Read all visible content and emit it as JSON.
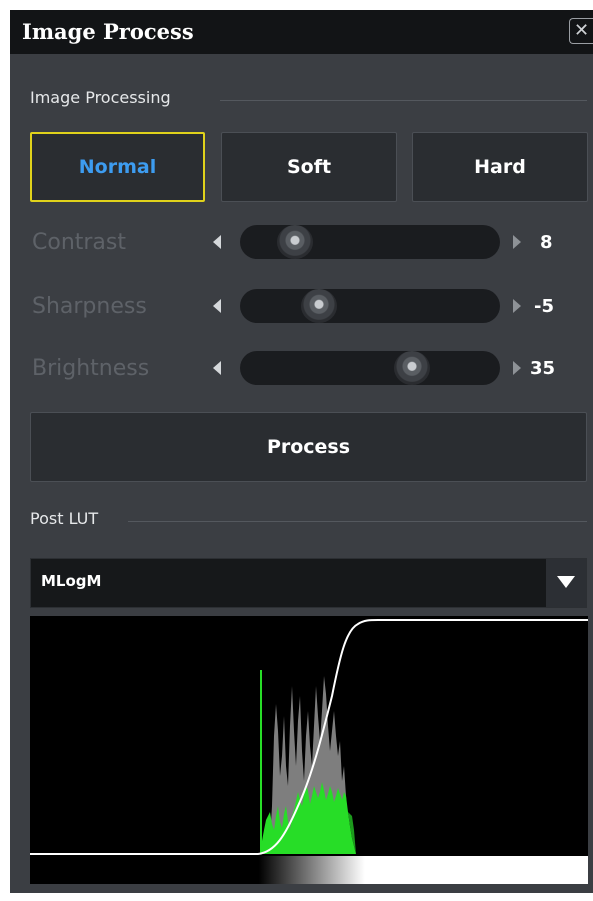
{
  "window": {
    "title": "Image Process",
    "close_icon_glyph": "✕"
  },
  "image_processing": {
    "section_label": "Image Processing",
    "modes": [
      {
        "label": "Normal",
        "active": true
      },
      {
        "label": "Soft",
        "active": false
      },
      {
        "label": "Hard",
        "active": false
      }
    ],
    "sliders": [
      {
        "label": "Contrast",
        "value": "8",
        "level": 0.16
      },
      {
        "label": "Sharpness",
        "value": "-5",
        "level": 0.27
      },
      {
        "label": "Brightness",
        "value": "35",
        "level": 0.69
      }
    ],
    "process_label": "Process"
  },
  "post_lut": {
    "section_label": "Post LUT",
    "selected": "MLogM",
    "dropdown_icon": "triangle-down-icon"
  },
  "colors": {
    "accent_border": "#e0d21b",
    "active_text": "#3d9cf0",
    "histogram_green": "#27dd27",
    "histogram_gray": "#7e7e7e",
    "curve": "#ffffff"
  }
}
